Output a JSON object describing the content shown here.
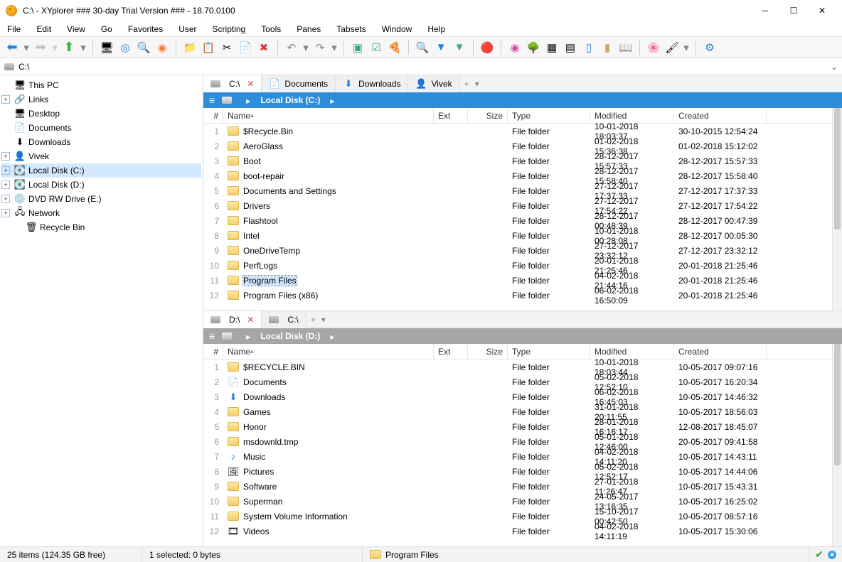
{
  "title": "C:\\ - XYplorer ### 30-day Trial Version ### - 18.70.0100",
  "menu": [
    "File",
    "Edit",
    "View",
    "Go",
    "Favorites",
    "User",
    "Scripting",
    "Tools",
    "Panes",
    "Tabsets",
    "Window",
    "Help"
  ],
  "address": "C:\\",
  "tree": [
    {
      "depth": 0,
      "exp": "",
      "icon": "🖥",
      "label": "This PC"
    },
    {
      "depth": 0,
      "exp": "+",
      "icon": "🔗",
      "label": "Links"
    },
    {
      "depth": 0,
      "exp": "",
      "icon": "🖥",
      "label": "Desktop"
    },
    {
      "depth": 0,
      "exp": "",
      "icon": "📄",
      "label": "Documents"
    },
    {
      "depth": 0,
      "exp": "",
      "icon": "⬇",
      "label": "Downloads"
    },
    {
      "depth": 0,
      "exp": "+",
      "icon": "👤",
      "label": "Vivek"
    },
    {
      "depth": 0,
      "exp": "+",
      "icon": "💽",
      "label": "Local Disk (C:)",
      "sel": true
    },
    {
      "depth": 0,
      "exp": "+",
      "icon": "💽",
      "label": "Local Disk (D:)"
    },
    {
      "depth": 0,
      "exp": "+",
      "icon": "💿",
      "label": "DVD RW Drive (E:)"
    },
    {
      "depth": 0,
      "exp": "+",
      "icon": "🖧",
      "label": "Network"
    },
    {
      "depth": 1,
      "exp": "",
      "icon": "🗑",
      "label": "Recycle Bin"
    }
  ],
  "pane1": {
    "tabs": [
      {
        "icon": "drive",
        "label": "C:\\",
        "active": true,
        "close": true
      },
      {
        "icon": "doc",
        "label": "Documents"
      },
      {
        "icon": "dl",
        "label": "Downloads"
      },
      {
        "icon": "user",
        "label": "Vivek"
      }
    ],
    "crumb": "Local Disk (C:)",
    "headers": [
      "#",
      "Name",
      "Ext",
      "Size",
      "Type",
      "Modified",
      "Created"
    ],
    "rows": [
      {
        "n": 1,
        "icon": "folder",
        "name": "$Recycle.Bin",
        "type": "File folder",
        "mod": "10-01-2018 18:03:37",
        "cr": "30-10-2015 12:54:24"
      },
      {
        "n": 2,
        "icon": "folder",
        "name": "AeroGlass",
        "type": "File folder",
        "mod": "01-02-2018 15:36:38",
        "cr": "01-02-2018 15:12:02"
      },
      {
        "n": 3,
        "icon": "folder",
        "name": "Boot",
        "type": "File folder",
        "mod": "28-12-2017 15:57:33",
        "cr": "28-12-2017 15:57:33"
      },
      {
        "n": 4,
        "icon": "folder",
        "name": "boot-repair",
        "type": "File folder",
        "mod": "28-12-2017 15:58:40",
        "cr": "28-12-2017 15:58:40"
      },
      {
        "n": 5,
        "icon": "folder",
        "name": "Documents and Settings",
        "type": "File folder",
        "mod": "27-12-2017 17:37:33",
        "cr": "27-12-2017 17:37:33"
      },
      {
        "n": 6,
        "icon": "folder",
        "name": "Drivers",
        "type": "File folder",
        "mod": "27-12-2017 17:54:22",
        "cr": "27-12-2017 17:54:22"
      },
      {
        "n": 7,
        "icon": "folder",
        "name": "Flashtool",
        "type": "File folder",
        "mod": "28-12-2017 00:48:39",
        "cr": "28-12-2017 00:47:39"
      },
      {
        "n": 8,
        "icon": "folder",
        "name": "Intel",
        "type": "File folder",
        "mod": "10-01-2018 00:28:08",
        "cr": "28-12-2017 00:05:30"
      },
      {
        "n": 9,
        "icon": "folder",
        "name": "OneDriveTemp",
        "type": "File folder",
        "mod": "27-12-2017 23:32:12",
        "cr": "27-12-2017 23:32:12"
      },
      {
        "n": 10,
        "icon": "folder",
        "name": "PerfLogs",
        "type": "File folder",
        "mod": "20-01-2018 21:25:46",
        "cr": "20-01-2018 21:25:46"
      },
      {
        "n": 11,
        "icon": "folder",
        "name": "Program Files",
        "type": "File folder",
        "mod": "04-02-2018 21:44:16",
        "cr": "20-01-2018 21:25:46",
        "sel": true
      },
      {
        "n": 12,
        "icon": "folder",
        "name": "Program Files (x86)",
        "type": "File folder",
        "mod": "06-02-2018 16:50:09",
        "cr": "20-01-2018 21:25:46"
      }
    ]
  },
  "pane2": {
    "tabs": [
      {
        "icon": "drive",
        "label": "D:\\",
        "active": true,
        "close": true
      },
      {
        "icon": "drive",
        "label": "C:\\"
      }
    ],
    "crumb": "Local Disk (D:)",
    "headers": [
      "#",
      "Name",
      "Ext",
      "Size",
      "Type",
      "Modified",
      "Created"
    ],
    "rows": [
      {
        "n": 1,
        "icon": "folder",
        "name": "$RECYCLE.BIN",
        "type": "File folder",
        "mod": "10-01-2018 18:03:44",
        "cr": "10-05-2017 09:07:16"
      },
      {
        "n": 2,
        "icon": "doc",
        "name": "Documents",
        "type": "File folder",
        "mod": "05-02-2018 12:52:10",
        "cr": "10-05-2017 16:20:34"
      },
      {
        "n": 3,
        "icon": "dl",
        "name": "Downloads",
        "type": "File folder",
        "mod": "06-02-2018 16:45:03",
        "cr": "10-05-2017 14:46:32"
      },
      {
        "n": 4,
        "icon": "folder",
        "name": "Games",
        "type": "File folder",
        "mod": "31-01-2018 20:11:55",
        "cr": "10-05-2017 18:56:03"
      },
      {
        "n": 5,
        "icon": "folder",
        "name": "Honor",
        "type": "File folder",
        "mod": "28-01-2018 16:16:17",
        "cr": "12-08-2017 18:45:07"
      },
      {
        "n": 6,
        "icon": "folder",
        "name": "msdownld.tmp",
        "type": "File folder",
        "mod": "05-01-2018 12:46:00",
        "cr": "20-05-2017 09:41:58"
      },
      {
        "n": 7,
        "icon": "music",
        "name": "Music",
        "type": "File folder",
        "mod": "04-02-2018 14:11:20",
        "cr": "10-05-2017 14:43:11"
      },
      {
        "n": 8,
        "icon": "pic",
        "name": "Pictures",
        "type": "File folder",
        "mod": "05-02-2018 12:52:17",
        "cr": "10-05-2017 14:44:06"
      },
      {
        "n": 9,
        "icon": "folder",
        "name": "Software",
        "type": "File folder",
        "mod": "27-01-2018 11:26:47",
        "cr": "10-05-2017 15:43:31"
      },
      {
        "n": 10,
        "icon": "folder",
        "name": "Superman",
        "type": "File folder",
        "mod": "24-05-2017 13:16:35",
        "cr": "10-05-2017 16:25:02"
      },
      {
        "n": 11,
        "icon": "folder",
        "name": "System Volume Information",
        "type": "File folder",
        "mod": "15-10-2017 00:42:50",
        "cr": "10-05-2017 08:57:16"
      },
      {
        "n": 12,
        "icon": "vid",
        "name": "Videos",
        "type": "File folder",
        "mod": "04-02-2018 14:11:19",
        "cr": "10-05-2017 15:30:06"
      }
    ]
  },
  "status": {
    "left": "25 items (124.35 GB free)",
    "sel": "1 selected: 0 bytes",
    "cur": "Program Files"
  }
}
